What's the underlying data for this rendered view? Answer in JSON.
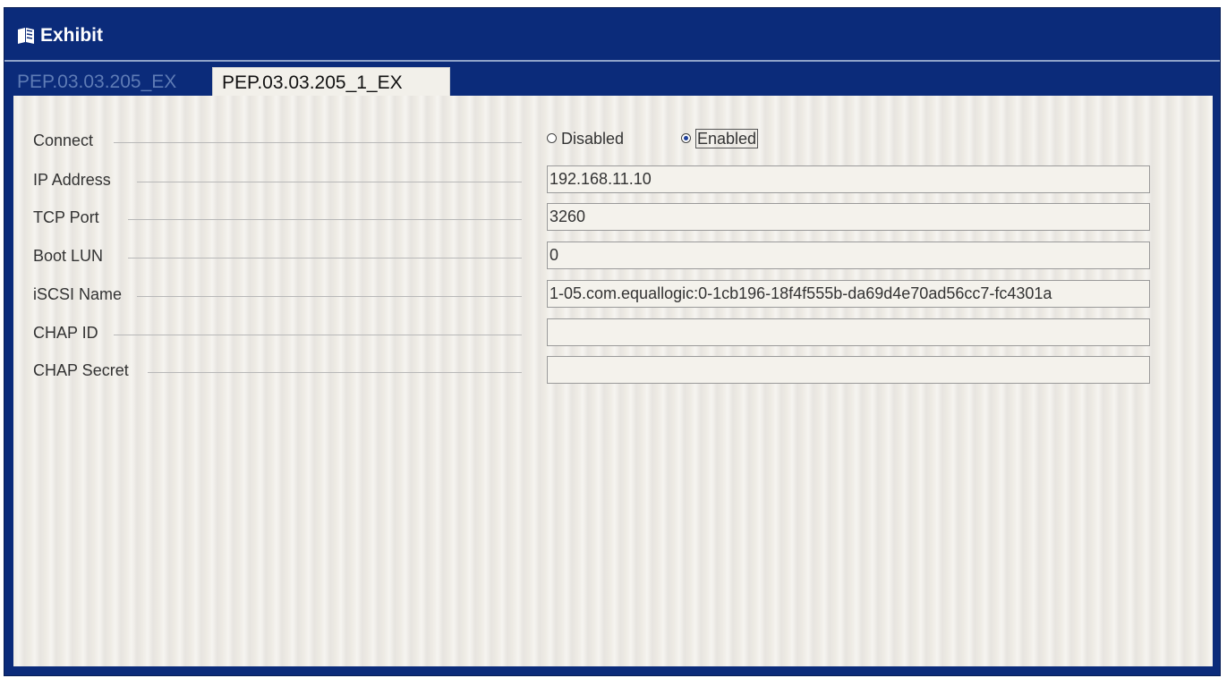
{
  "window": {
    "title": "Exhibit",
    "title_icon": "book-icon"
  },
  "tabs": [
    {
      "label": "PEP.03.03.205_EX",
      "active": false
    },
    {
      "label": "PEP.03.03.205_1_EX",
      "active": true
    }
  ],
  "form": {
    "connect": {
      "label": "Connect",
      "options": [
        {
          "label": "Disabled",
          "selected": false
        },
        {
          "label": "Enabled",
          "selected": true
        }
      ]
    },
    "ip_address": {
      "label": "IP Address",
      "value": "192.168.11.10"
    },
    "tcp_port": {
      "label": "TCP Port",
      "value": "3260"
    },
    "boot_lun": {
      "label": "Boot LUN",
      "value": "0"
    },
    "iscsi_name": {
      "label": "iSCSI Name",
      "value": "1-05.com.equallogic:0-1cb196-18f4f555b-da69d4e70ad56cc7-fc4301a"
    },
    "chap_id": {
      "label": "CHAP ID",
      "value": ""
    },
    "chap_secret": {
      "label": "CHAP Secret",
      "value": ""
    }
  },
  "colors": {
    "titlebar": "#0b2b7a",
    "panel": "#eeebe4",
    "radio_selected": "#1f3f9a"
  }
}
